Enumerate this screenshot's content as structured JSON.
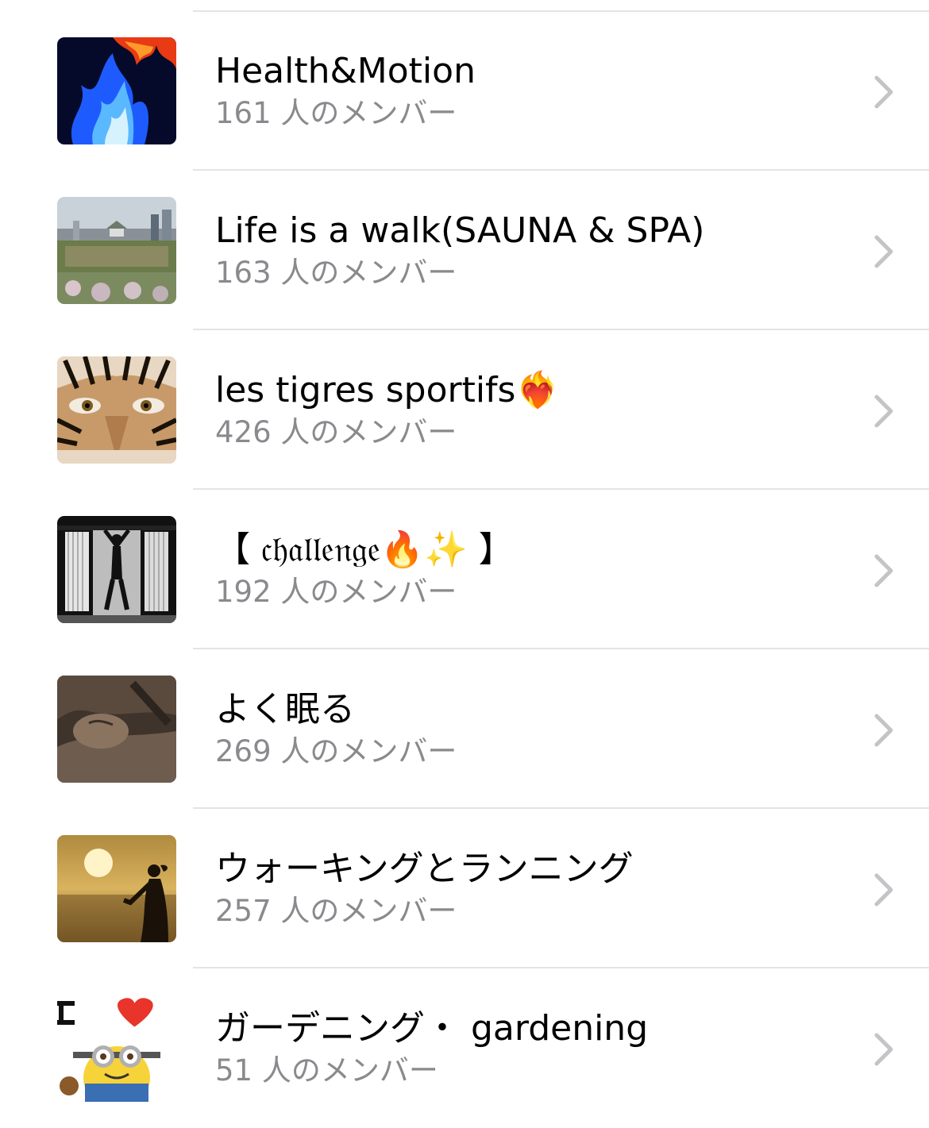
{
  "groups": [
    {
      "name": "Health&Motion",
      "members": "161 人のメンバー",
      "thumbnail_icon": "blue-fire-thumbnail"
    },
    {
      "name": "Life is a walk(SAUNA & SPA)",
      "members": "163 人のメンバー",
      "thumbnail_icon": "city-castle-thumbnail"
    },
    {
      "name": "les tigres sportifs❤️‍🔥",
      "members": "426 人のメンバー",
      "thumbnail_icon": "tiger-face-thumbnail"
    },
    {
      "name": "【 𝔠𝔥𝔞𝔩𝔩𝔢𝔫𝔤𝔢🔥✨ 】",
      "members": "192 人のメンバー",
      "thumbnail_icon": "gym-silhouette-thumbnail"
    },
    {
      "name": "よく眠る",
      "members": "269 人のメンバー",
      "thumbnail_icon": "sleeping-cat-thumbnail"
    },
    {
      "name": "ウォーキングとランニング",
      "members": "257 人のメンバー",
      "thumbnail_icon": "sunset-runner-thumbnail"
    },
    {
      "name": "ガーデニング・ gardening",
      "members": "51 人のメンバー",
      "thumbnail_icon": "minion-heart-thumbnail"
    }
  ],
  "colors": {
    "primary_text": "#000000",
    "secondary_text": "#8a8a8e",
    "separator": "#e4e4e6",
    "chevron": "#c4c4c7"
  },
  "row_action_icon": "chevron-right-icon"
}
